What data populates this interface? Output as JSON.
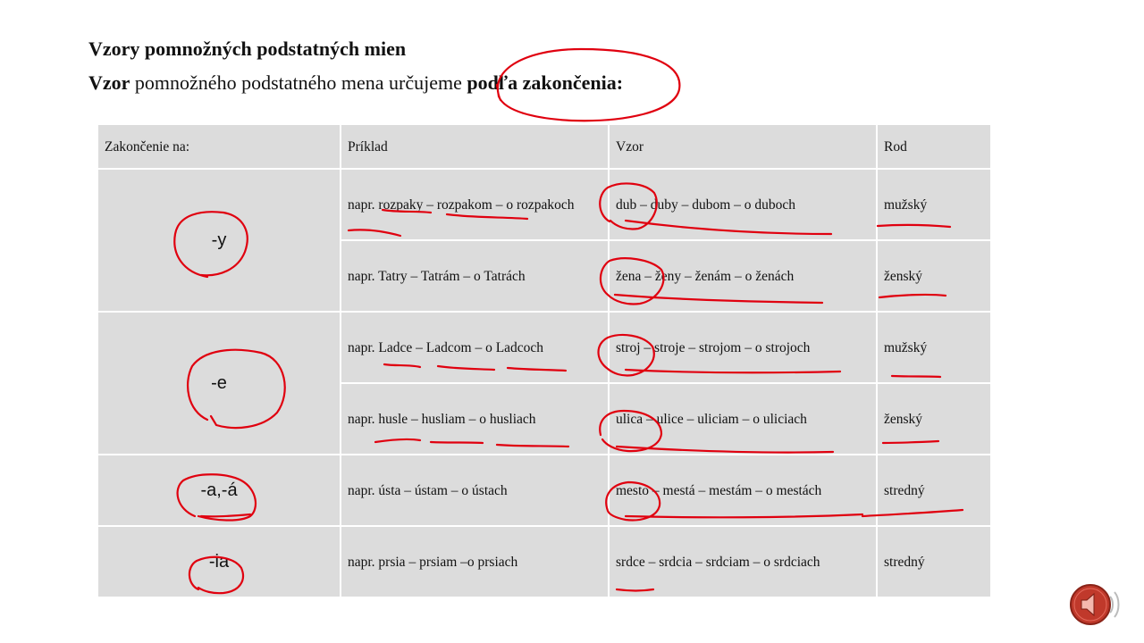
{
  "title": "Vzory pomnožných podstatných mien",
  "subtitle": {
    "bold_start": "Vzor",
    "middle": " pomnožného podstatného mena určujeme ",
    "bold_end": "podľa zakončenia:"
  },
  "table": {
    "headers": [
      "Zakončenie na:",
      "Príklad",
      "Vzor",
      "Rod"
    ],
    "groups": [
      {
        "ending": "-y",
        "rows": [
          {
            "example": "napr. rozpaky – rozpakom – o rozpakoch",
            "pattern": "dub – duby – dubom – o duboch",
            "gender": "mužský"
          },
          {
            "example": "napr. Tatry – Tatrám – o Tatrách",
            "pattern": "žena – ženy – ženám – o ženách",
            "gender": "ženský"
          }
        ]
      },
      {
        "ending": "-e",
        "rows": [
          {
            "example": "napr. Ladce – Ladcom – o Ladcoch",
            "pattern": "stroj – stroje – strojom – o strojoch",
            "gender": "mužský"
          },
          {
            "example": "napr. husle – husliam – o husliach",
            "pattern": "ulica – ulice – uliciam – o uliciach",
            "gender": "ženský"
          }
        ]
      },
      {
        "ending": "-a,-á",
        "rows": [
          {
            "example": "napr. ústa – ústam – o ústach",
            "pattern": "mesto – mestá – mestám – o mestách",
            "gender": "stredný"
          }
        ]
      },
      {
        "ending": "-ia",
        "rows": [
          {
            "example": "napr. prsia – prsiam –o prsiach",
            "pattern": "srdce – srdcia – srdciam – o srdciach",
            "gender": "stredný"
          }
        ]
      }
    ]
  },
  "colors": {
    "annotation": "#e0000f",
    "table_cell": "#dcdcdc",
    "speaker_badge": "#c0392b"
  },
  "icons": {
    "audio": "speaker-icon"
  }
}
